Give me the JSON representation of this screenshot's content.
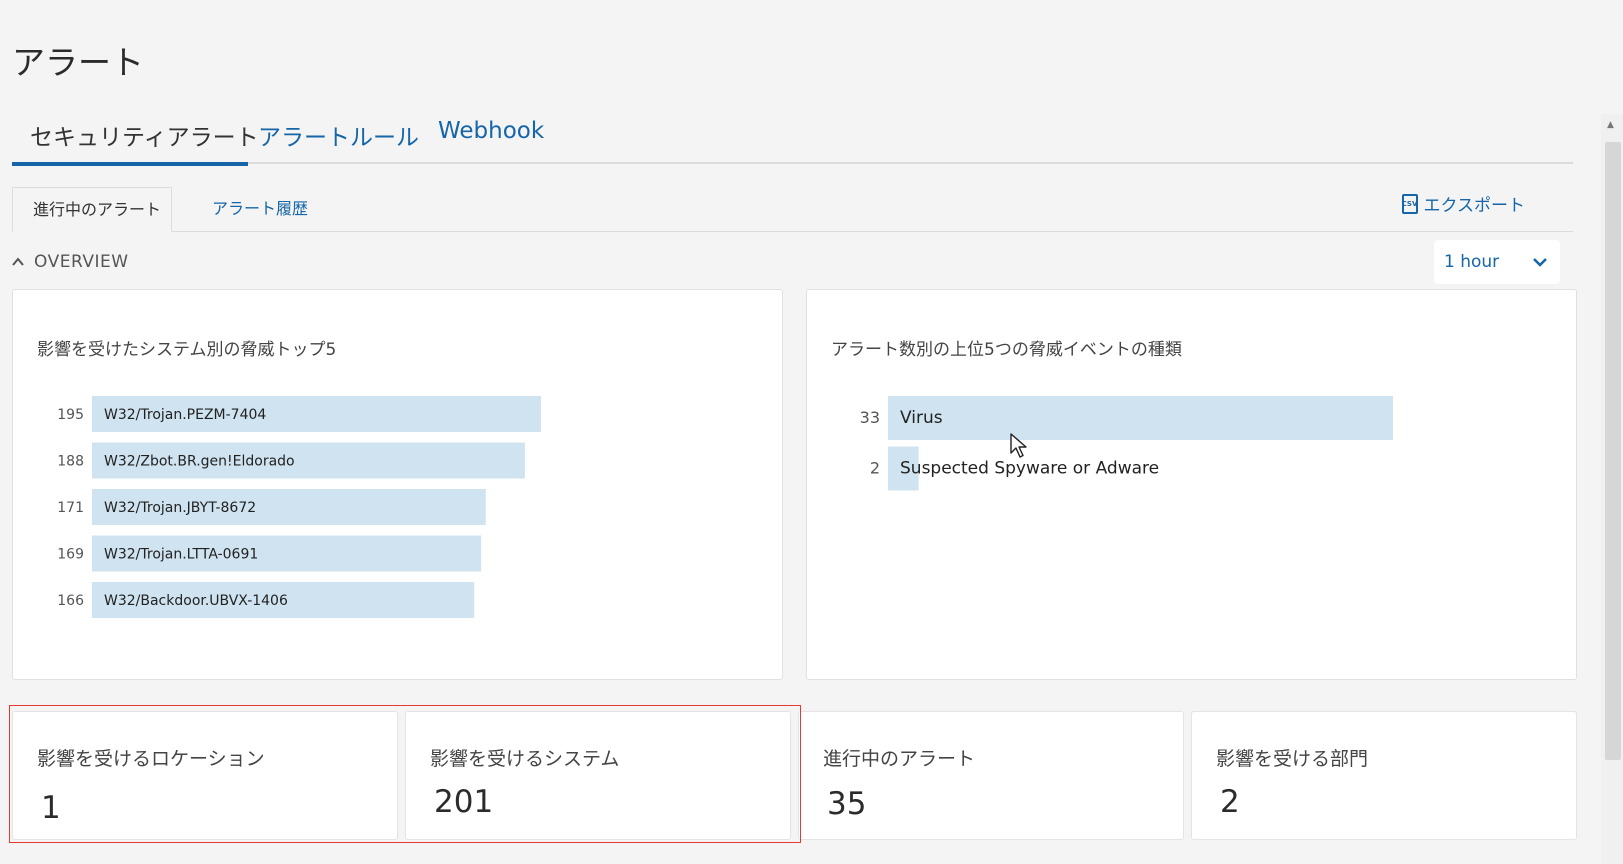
{
  "page": {
    "title": "アラート"
  },
  "main_tabs": [
    {
      "label": "セキュリティアラート",
      "active": true
    },
    {
      "label": "アラートルール",
      "active": false
    },
    {
      "label": "Webhook",
      "active": false
    }
  ],
  "sub_tabs": [
    {
      "label": "進行中のアラート",
      "active": true
    },
    {
      "label": "アラート履歴",
      "active": false
    }
  ],
  "export": {
    "label": "エクスポート",
    "icon": "csv-file-icon"
  },
  "overview": {
    "label": "OVERVIEW"
  },
  "time_range": {
    "selected": "1 hour"
  },
  "colors": {
    "accent": "#1565a8",
    "bar": "#cfe3f0",
    "highlight": "#e53935"
  },
  "chart_data": [
    {
      "type": "bar",
      "orientation": "horizontal",
      "title": "影響を受けたシステム別の脅威トップ5",
      "categories": [
        "W32/Trojan.PEZM-7404",
        "W32/Zbot.BR.gen!Eldorado",
        "W32/Trojan.JBYT-8672",
        "W32/Trojan.LTTA-0691",
        "W32/Backdoor.UBVX-1406"
      ],
      "values": [
        195,
        188,
        171,
        169,
        166
      ],
      "xlim": [
        0,
        195
      ]
    },
    {
      "type": "bar",
      "orientation": "horizontal",
      "title": "アラート数別の上位5つの脅威イベントの種類",
      "categories": [
        "Virus",
        "Suspected Spyware or Adware"
      ],
      "values": [
        33,
        2
      ],
      "xlim": [
        0,
        33
      ]
    }
  ],
  "stats": [
    {
      "label": "影響を受けるロケーション",
      "value": "1"
    },
    {
      "label": "影響を受けるシステム",
      "value": "201"
    },
    {
      "label": "進行中のアラート",
      "value": "35"
    },
    {
      "label": "影響を受ける部門",
      "value": "2"
    }
  ]
}
